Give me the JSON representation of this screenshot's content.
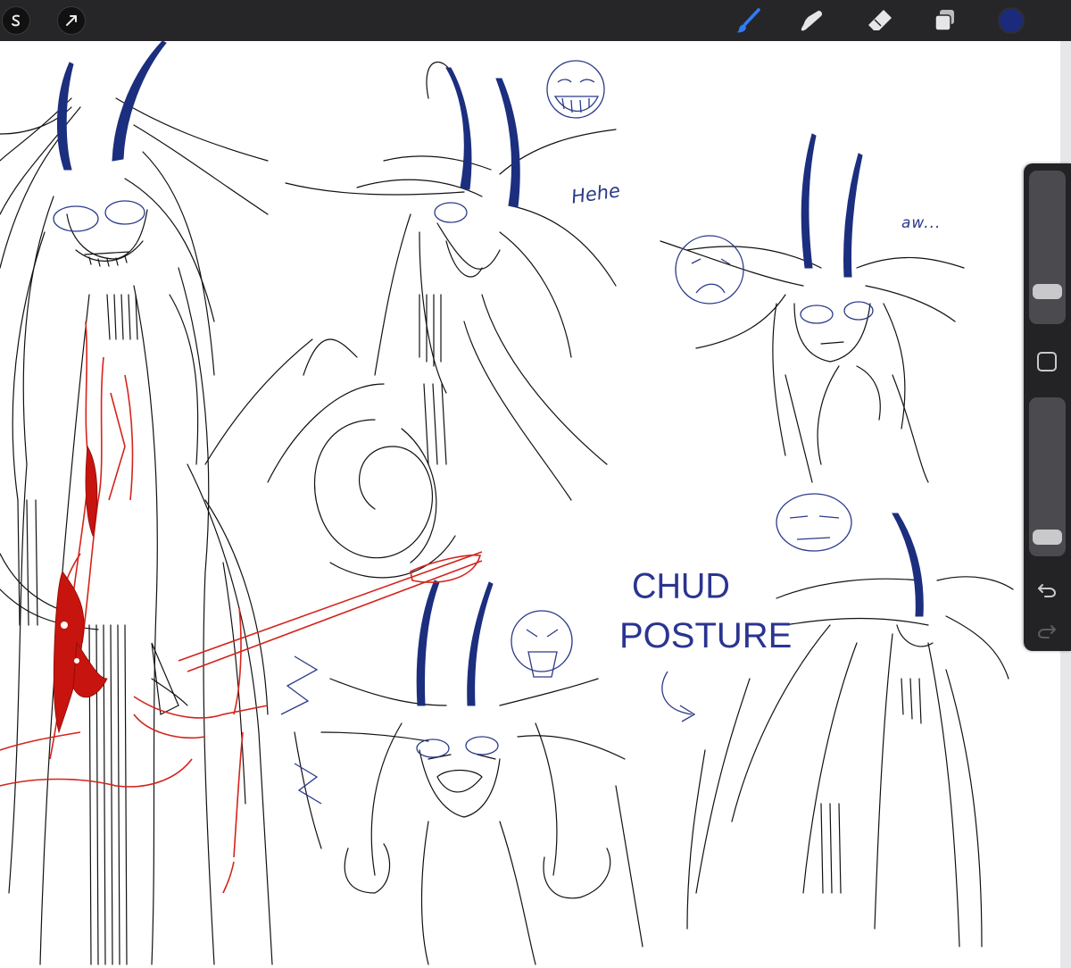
{
  "app": {
    "toolbar": {
      "left": [
        {
          "name": "gallery",
          "icon": "procreate-s-icon"
        },
        {
          "name": "actions",
          "icon": "cursor-arrow-icon"
        }
      ],
      "right": [
        {
          "name": "brush",
          "icon": "brush-icon",
          "active": true,
          "color": "#2f7cf6"
        },
        {
          "name": "smudge",
          "icon": "smudge-finger-icon",
          "active": false
        },
        {
          "name": "eraser",
          "icon": "eraser-icon",
          "active": false
        },
        {
          "name": "layers",
          "icon": "layers-icon",
          "active": false
        },
        {
          "name": "color",
          "icon": "color-swatch-icon",
          "value": "#1b2a7a"
        }
      ]
    },
    "sidebar": {
      "brush_size": 0.16,
      "opacity": 0.06,
      "undo_icon": "undo-icon",
      "redo_icon": "redo-icon",
      "modify_icon": "square-modify-icon"
    }
  },
  "canvas": {
    "annotations": {
      "hehe": "Hehe",
      "aw": "aw...",
      "chud": "CHUD",
      "posture": "POSTURE"
    },
    "ink_colors": {
      "line": "#111111",
      "horns": "#1c2e7e",
      "blood": "#d4241c",
      "notes": "#2a3a8a"
    }
  }
}
